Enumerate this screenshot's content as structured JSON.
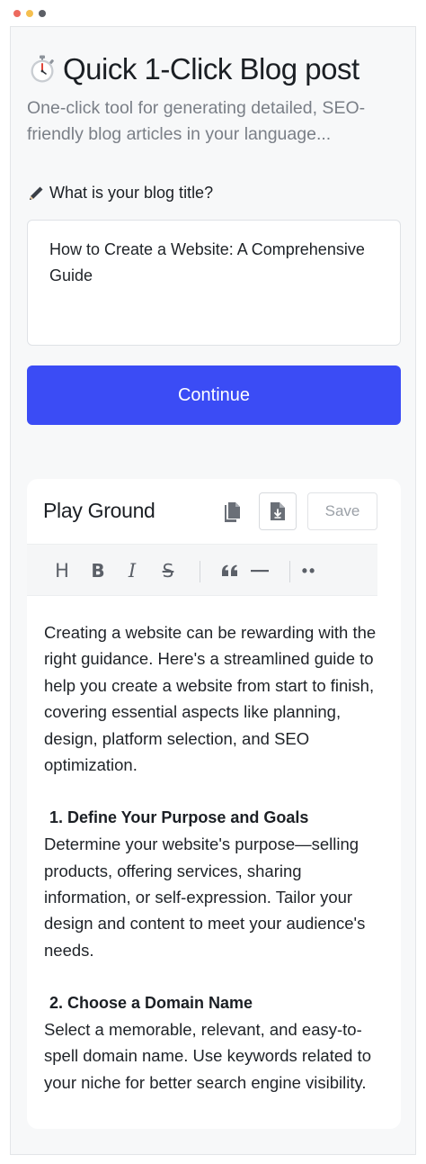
{
  "window": {
    "dots": [
      "#ed6a5e",
      "#f5bf4f",
      "#5c5f66"
    ]
  },
  "header": {
    "title_icon": "stopwatch-icon",
    "title": "Quick 1-Click Blog post",
    "subtitle": "One-click tool for generating detailed, SEO-friendly blog articles in your language..."
  },
  "form": {
    "label_icon": "pencil-icon",
    "label": "What is your blog title?",
    "title_value": "How to Create a Website: A Comprehensive Guide",
    "continue_label": "Continue"
  },
  "colors": {
    "accent": "#3b4cf5",
    "page_bg": "#f7f8f9",
    "card_bg": "#ffffff"
  },
  "playground": {
    "title": "Play Ground",
    "copy_icon": "copy-icon",
    "download_icon": "download-icon",
    "save_label": "Save",
    "toolbar": {
      "heading": "H",
      "bold": "B",
      "italic": "I",
      "strike": "S",
      "quote": "“",
      "more": "••"
    },
    "content": {
      "intro": "Creating a website can be rewarding with the right guidance. Here's a streamlined guide to help you create a website from start to finish, covering essential aspects like planning, design, platform selection, and SEO optimization.",
      "sections": [
        {
          "heading": "1. Define Your Purpose and Goals",
          "body": "Determine your website's purpose—selling products, offering services, sharing information, or self-expression. Tailor your design and content to meet your audience's needs."
        },
        {
          "heading": "2. Choose a Domain Name",
          "body": "Select a memorable, relevant, and easy-to-spell domain name. Use keywords related to your niche for better search engine visibility."
        }
      ]
    }
  }
}
